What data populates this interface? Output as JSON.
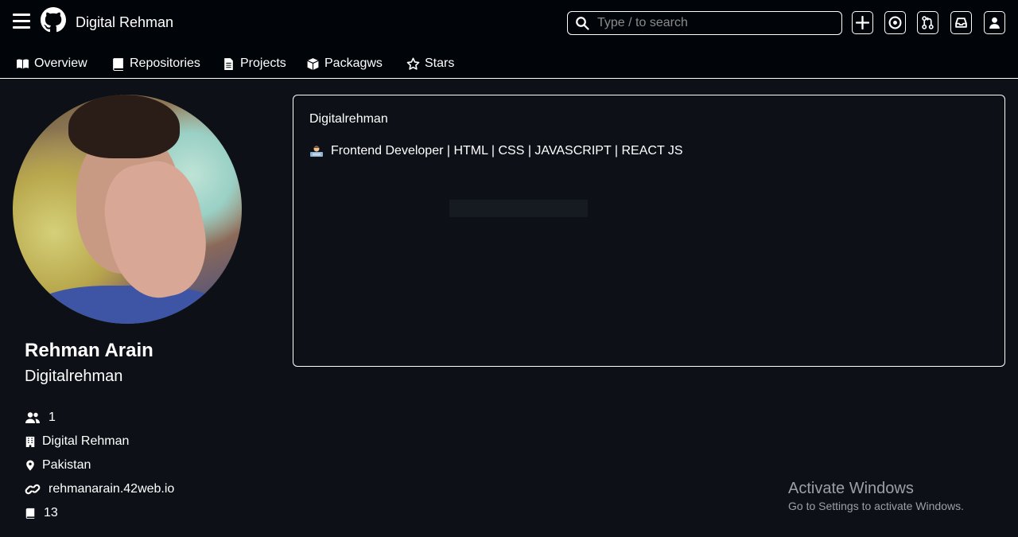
{
  "header": {
    "brand": "Digital Rehman",
    "search_placeholder": "Type / to search"
  },
  "tabs": [
    {
      "label": "Overview",
      "icon": "book-open-icon"
    },
    {
      "label": "Repositories",
      "icon": "repo-icon"
    },
    {
      "label": "Projects",
      "icon": "file-icon"
    },
    {
      "label": "Packagws",
      "icon": "package-icon"
    },
    {
      "label": "Stars",
      "icon": "star-icon"
    }
  ],
  "profile": {
    "name": "Rehman Arain",
    "login": "Digitalrehman",
    "followers": "1",
    "company": "Digital Rehman",
    "location": "Pakistan",
    "website": "rehmanarain.42web.io",
    "repos": "13"
  },
  "readme": {
    "title": "Digitalrehman",
    "bio": "Frontend Developer | HTML | CSS | JAVASCRIPT | REACT JS"
  },
  "watermark": {
    "line1": "Activate Windows",
    "line2": "Go to Settings to activate Windows."
  },
  "colors": {
    "background": "#0d1117",
    "topbar": "#010409",
    "text": "#ffffff",
    "border": "#ffffff"
  }
}
